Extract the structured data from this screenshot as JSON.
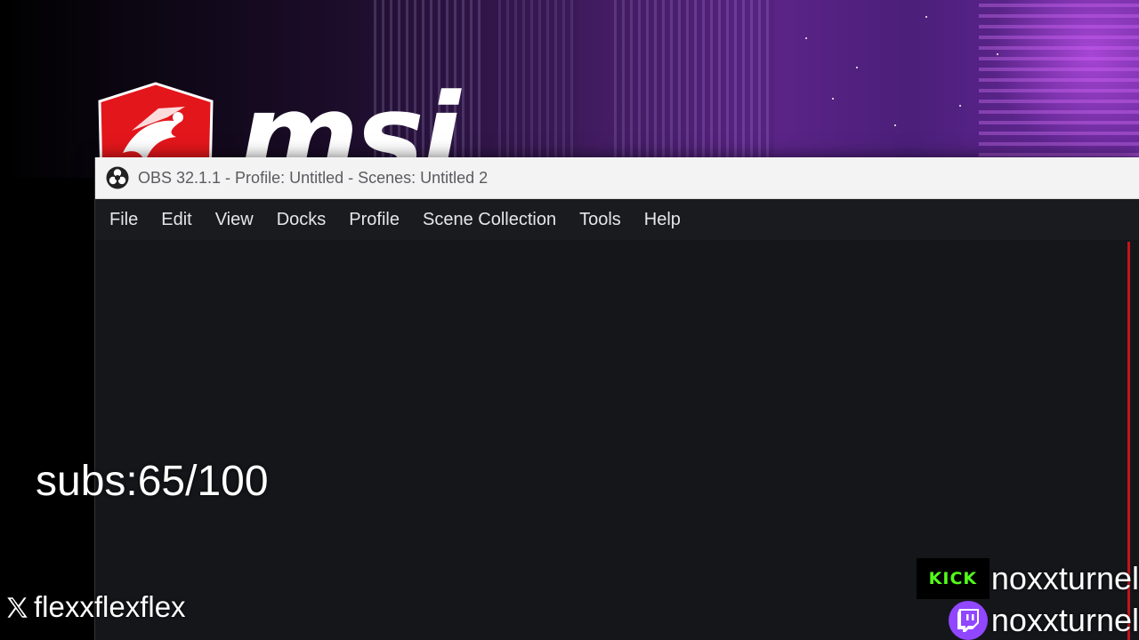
{
  "wallpaper": {
    "logo_text": "msi",
    "accent_color": "#c3161b",
    "brand_icon": "msi-dragon-shield-icon"
  },
  "window": {
    "title": "OBS 32.1.1 - Profile: Untitled - Scenes: Untitled 2",
    "app_icon": "obs-icon"
  },
  "menubar": {
    "items": [
      {
        "label": "File"
      },
      {
        "label": "Edit"
      },
      {
        "label": "View"
      },
      {
        "label": "Docks"
      },
      {
        "label": "Profile"
      },
      {
        "label": "Scene Collection"
      },
      {
        "label": "Tools"
      },
      {
        "label": "Help"
      }
    ]
  },
  "overlay": {
    "subs": "subs:65/100",
    "x_handle": "flexxflexflex",
    "x_icon": "x-logo-icon",
    "kick_label": "KICK",
    "kick_handle": "noxxturnel",
    "kick_color": "#53fc18",
    "twitch_handle": "noxxturnel",
    "twitch_icon": "twitch-icon",
    "twitch_color": "#9146ff"
  }
}
